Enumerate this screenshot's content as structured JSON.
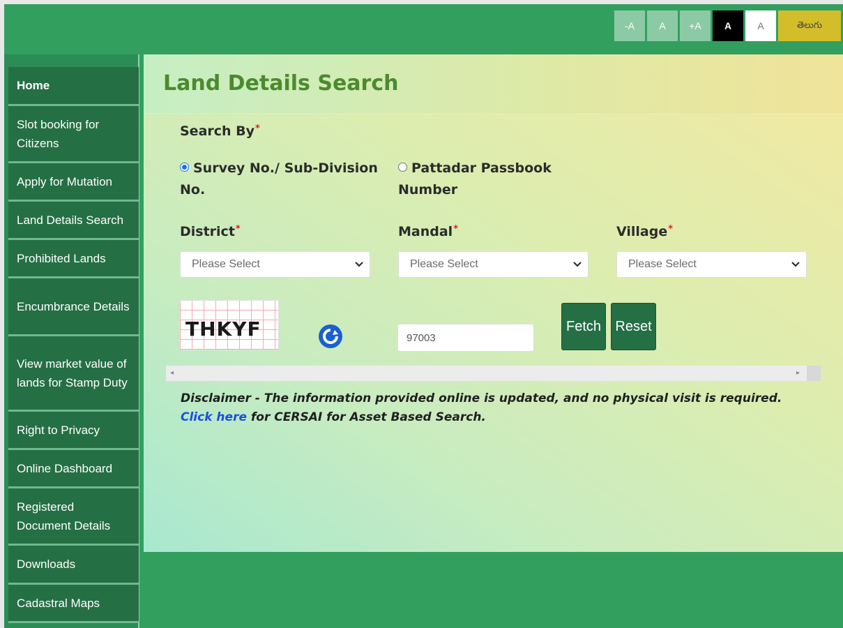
{
  "font_controls": {
    "decrease": "-A",
    "normal": "A",
    "increase": "+A",
    "dark_theme": "A",
    "light_theme": "A",
    "language": "తెలుగు"
  },
  "sidebar": {
    "items": [
      {
        "label": "Home"
      },
      {
        "label": "Slot booking for Citizens"
      },
      {
        "label": "Apply for Mutation"
      },
      {
        "label": "Land Details Search"
      },
      {
        "label": "Prohibited Lands"
      },
      {
        "label": "Encumbrance Details"
      },
      {
        "label": "View market value of lands for Stamp Duty"
      },
      {
        "label": "Right to Privacy"
      },
      {
        "label": "Online Dashboard"
      },
      {
        "label": "Registered Document Details"
      },
      {
        "label": "Downloads"
      },
      {
        "label": "Cadastral Maps"
      }
    ]
  },
  "main": {
    "title": "Land Details Search",
    "search_by_label": "Search By",
    "required_mark": "*",
    "radio_survey": "Survey No./ Sub-Division No.",
    "radio_pattadar": "Pattadar Passbook Number",
    "district_label": "District",
    "mandal_label": "Mandal",
    "village_label": "Village",
    "select_placeholder": "Please Select",
    "captcha_text": "THKYF",
    "captcha_input_value": "97003",
    "fetch_label": "Fetch",
    "reset_label": "Reset",
    "disclaimer": "Disclaimer - The information provided online is updated, and no physical visit is required.",
    "click_here": "Click here",
    "cersai_text": " for CERSAI for Asset Based Search."
  },
  "colors": {
    "header_green": "#339f5f",
    "sidebar_item": "#256f45",
    "title_green": "#4c8a2e",
    "link_blue": "#1a4fe0",
    "language_button": "#d4bd2a"
  }
}
